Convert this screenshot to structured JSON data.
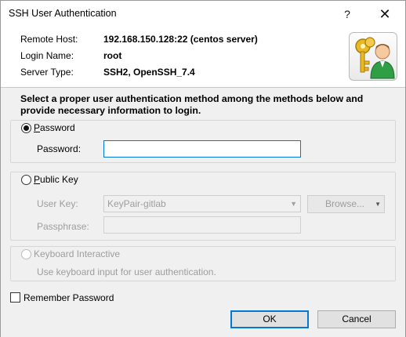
{
  "window": {
    "title": "SSH User Authentication",
    "help_label": "?",
    "close_label": "✕"
  },
  "info": {
    "remote_host_label": "Remote Host:",
    "remote_host_value": "192.168.150.128:22 (centos server)",
    "login_name_label": "Login Name:",
    "login_name_value": "root",
    "server_type_label": "Server Type:",
    "server_type_value": "SSH2, OpenSSH_7.4",
    "app_icon": "keys-user-icon"
  },
  "instruction": "Select a proper user authentication method among the methods below and provide necessary information to login.",
  "password_method": {
    "radio_label_first": "P",
    "radio_label_rest": "assword",
    "field_label": "Password:",
    "value": "",
    "selected": true
  },
  "public_key_method": {
    "radio_label_first": "P",
    "radio_label_rest": "ublic Key",
    "user_key_label": "User Key:",
    "user_key_value": "KeyPair-gitlab",
    "browse_label": "Browse...",
    "passphrase_label": "Passphrase:",
    "passphrase_value": "",
    "selected": false
  },
  "keyboard_method": {
    "radio_label": "Keyboard Interactive",
    "description": "Use keyboard input for user authentication.",
    "enabled": false
  },
  "remember_password": {
    "label": "Remember Password",
    "checked": false
  },
  "buttons": {
    "ok": "OK",
    "cancel": "Cancel"
  },
  "colors": {
    "accent": "#0078d7",
    "panel_bg": "#f0f0f0",
    "disabled_text": "#9d9d9d"
  }
}
